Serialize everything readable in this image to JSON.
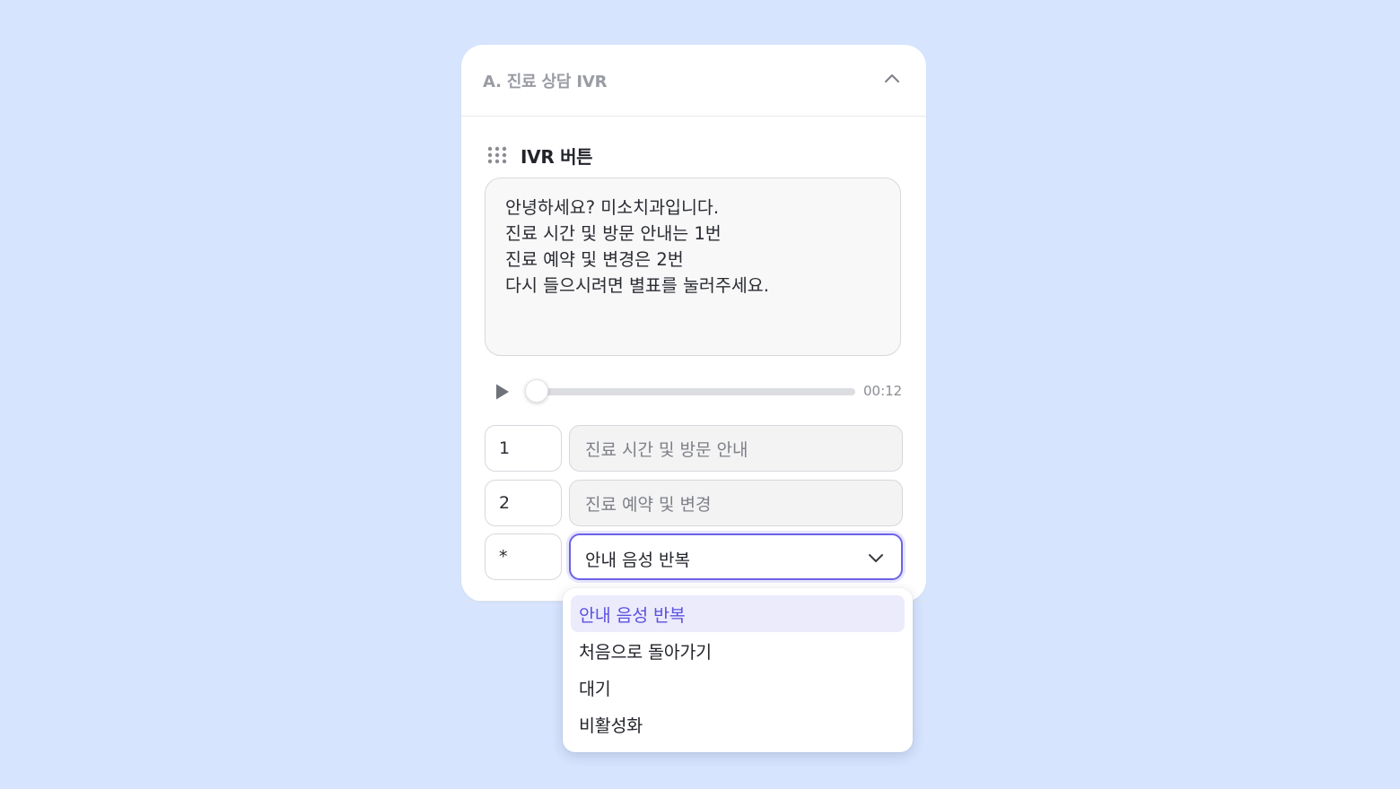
{
  "panel": {
    "title": "A. 진료 상담 IVR",
    "collapse_icon": "chevron-up-icon"
  },
  "section": {
    "drag_icon": "drag-handle-icon",
    "title": "IVR 버튼"
  },
  "message": {
    "text": "안녕하세요? 미소치과입니다.\n진료 시간 및 방문 안내는 1번\n진료 예약 및 변경은 2번\n다시 들으시려면 별표를 눌러주세요."
  },
  "player": {
    "play_icon": "play-icon",
    "progress": 0,
    "duration": "00:12"
  },
  "options": [
    {
      "key": "1",
      "label": "진료 시간 및 방문 안내"
    },
    {
      "key": "2",
      "label": "진료 예약 및 변경"
    },
    {
      "key": "*",
      "label": "안내 음성 반복"
    }
  ],
  "dropdown": {
    "selected": "안내 음성 반복",
    "items": [
      {
        "label": "안내 음성 반복",
        "selected": true
      },
      {
        "label": "처음으로 돌아가기",
        "selected": false
      },
      {
        "label": "대기",
        "selected": false
      },
      {
        "label": "비활성화",
        "selected": false
      }
    ]
  },
  "colors": {
    "background": "#d6e4fe",
    "accent": "#6b62e8",
    "accent_text": "#5b52df",
    "selected_bg": "#ecebfc"
  }
}
